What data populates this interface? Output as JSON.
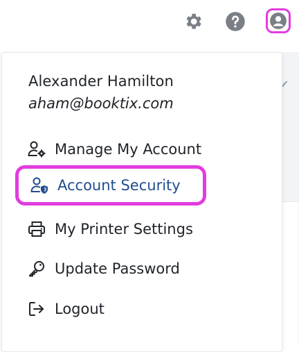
{
  "topbar": {
    "icons": [
      "settings-icon",
      "help-icon",
      "user-profile-icon"
    ],
    "highlight_color": "#e23cdf"
  },
  "user": {
    "name": "Alexander Hamilton",
    "email": "aham@booktix.com"
  },
  "menu": {
    "items": [
      {
        "label": "Manage My Account",
        "icon": "user-gear-icon"
      },
      {
        "label": "Account Security",
        "icon": "user-shield-icon",
        "selected": true,
        "color": "#214d8f"
      },
      {
        "label": "My Printer Settings",
        "icon": "printer-icon"
      },
      {
        "label": "Update Password",
        "icon": "key-icon"
      },
      {
        "label": "Logout",
        "icon": "logout-icon"
      }
    ]
  }
}
